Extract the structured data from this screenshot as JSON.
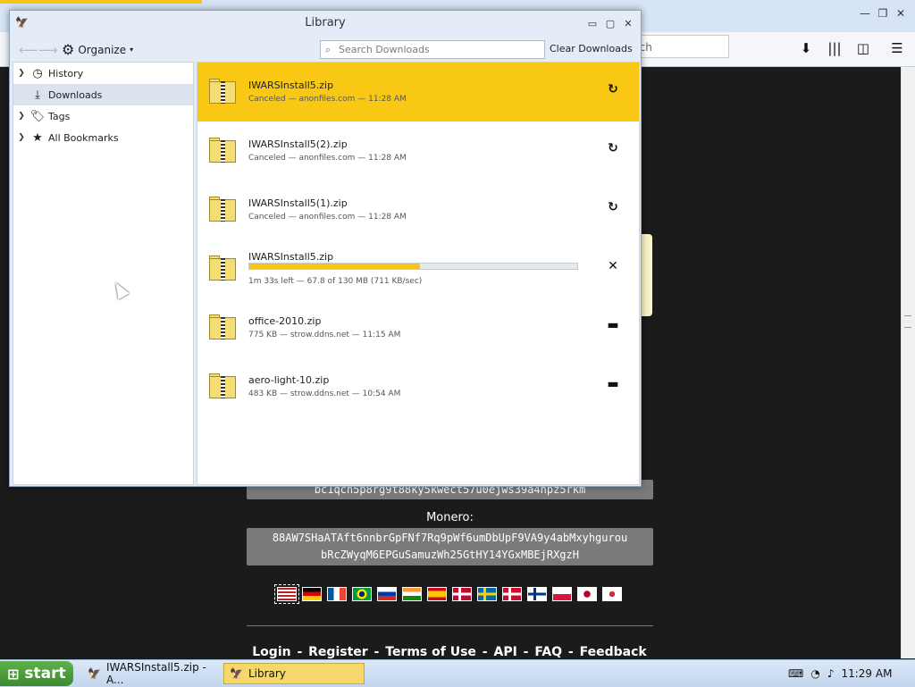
{
  "background": {
    "search_placeholder": "rch",
    "bitcoin_address": "bc1qch5p8rg9t88ky5kwect57u0ejws39a4hpz5rkm",
    "monero_label": "Monero:",
    "monero_address_line1": "88AW7SHaATAft6nnbrGpFNf7Rq9pWf6umDbUpF9VA9y4abMxyhgurou",
    "monero_address_line2": "bRcZWyqM6EPGuSamuzWh25GtHY14YGxMBEjRXgzH",
    "flags": [
      "us",
      "de",
      "fr",
      "br",
      "ru",
      "in",
      "es",
      "no",
      "se",
      "dk",
      "fi",
      "pl",
      "jp",
      "kr"
    ],
    "footer_links": [
      "Login",
      "Register",
      "Terms of Use",
      "API",
      "FAQ",
      "Feedback"
    ],
    "footer_separator": " - "
  },
  "library": {
    "title": "Library",
    "organize_label": "Organize",
    "search_placeholder": "Search Downloads",
    "clear_label": "Clear Downloads",
    "sidebar": [
      {
        "label": "History",
        "icon": "clock-icon"
      },
      {
        "label": "Downloads",
        "icon": "download-icon"
      },
      {
        "label": "Tags",
        "icon": "tag-icon"
      },
      {
        "label": "All Bookmarks",
        "icon": "star-icon"
      }
    ],
    "downloads": [
      {
        "name": "IWARSInstall5.zip",
        "status": "Canceled — anonfiles.com — 11:28 AM",
        "action": "retry"
      },
      {
        "name": "IWARSInstall5(2).zip",
        "status": "Canceled — anonfiles.com — 11:28 AM",
        "action": "retry"
      },
      {
        "name": "IWARSInstall5(1).zip",
        "status": "Canceled — anonfiles.com — 11:28 AM",
        "action": "retry"
      },
      {
        "name": "IWARSInstall5.zip",
        "status": "1m 33s left — 67.8 of 130 MB (711 KB/sec)",
        "action": "cancel",
        "progress": 0.52
      },
      {
        "name": "office-2010.zip",
        "status": "775 KB — strow.ddns.net — 11:15 AM",
        "action": "open-folder"
      },
      {
        "name": "aero-light-10.zip",
        "status": "483 KB — strow.ddns.net — 10:54 AM",
        "action": "open-folder"
      }
    ]
  },
  "taskbar": {
    "start_label": "start",
    "tasks": [
      {
        "label": "IWARSInstall5.zip - A..."
      },
      {
        "label": "Library"
      }
    ],
    "clock": "11:29 AM"
  },
  "colors": {
    "accent": "#f9c815",
    "page_bg": "#1b1b1b",
    "taskbar": "#c8daf0",
    "start": "#4a9c3b"
  }
}
